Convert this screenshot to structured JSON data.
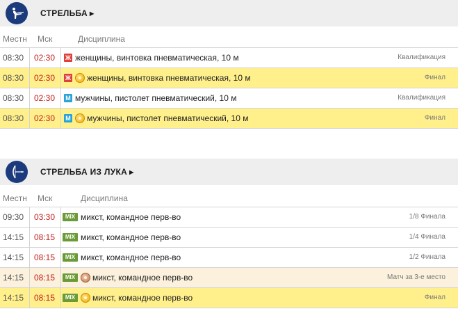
{
  "columns": {
    "local": "Местн",
    "moscow": "Мск",
    "discipline": "Дисциплина"
  },
  "sections": [
    {
      "title": "СТРЕЛЬБА",
      "icon": "shooting-icon",
      "rows": [
        {
          "local": "08:30",
          "moscow": "02:30",
          "badge": "Ж",
          "badge_type": "w",
          "medal": "",
          "discipline": "женщины, винтовка пневматическая, 10 м",
          "stage": "Квалификация"
        },
        {
          "local": "08:30",
          "moscow": "02:30",
          "badge": "Ж",
          "badge_type": "w",
          "medal": "gold",
          "discipline": "женщины, винтовка пневматическая, 10 м",
          "stage": "Финал"
        },
        {
          "local": "08:30",
          "moscow": "02:30",
          "badge": "М",
          "badge_type": "m",
          "medal": "",
          "discipline": "мужчины, пистолет пневматический, 10 м",
          "stage": "Квалификация"
        },
        {
          "local": "08:30",
          "moscow": "02:30",
          "badge": "М",
          "badge_type": "m",
          "medal": "gold",
          "discipline": "мужчины, пистолет пневматический, 10 м",
          "stage": "Финал"
        }
      ]
    },
    {
      "title": "СТРЕЛЬБА ИЗ ЛУКА",
      "icon": "archery-icon",
      "rows": [
        {
          "local": "09:30",
          "moscow": "03:30",
          "badge": "MIX",
          "badge_type": "mix",
          "medal": "",
          "discipline": "микст, командное перв-во",
          "stage": "1/8 Финала"
        },
        {
          "local": "14:15",
          "moscow": "08:15",
          "badge": "MIX",
          "badge_type": "mix",
          "medal": "",
          "discipline": "микст, командное перв-во",
          "stage": "1/4 Финала"
        },
        {
          "local": "14:15",
          "moscow": "08:15",
          "badge": "MIX",
          "badge_type": "mix",
          "medal": "",
          "discipline": "микст, командное перв-во",
          "stage": "1/2 Финала"
        },
        {
          "local": "14:15",
          "moscow": "08:15",
          "badge": "MIX",
          "badge_type": "mix",
          "medal": "bronze",
          "discipline": "микст, командное перв-во",
          "stage": "Матч за 3-е место"
        },
        {
          "local": "14:15",
          "moscow": "08:15",
          "badge": "MIX",
          "badge_type": "mix",
          "medal": "gold",
          "discipline": "микст, командное перв-во",
          "stage": "Финал"
        }
      ]
    }
  ]
}
